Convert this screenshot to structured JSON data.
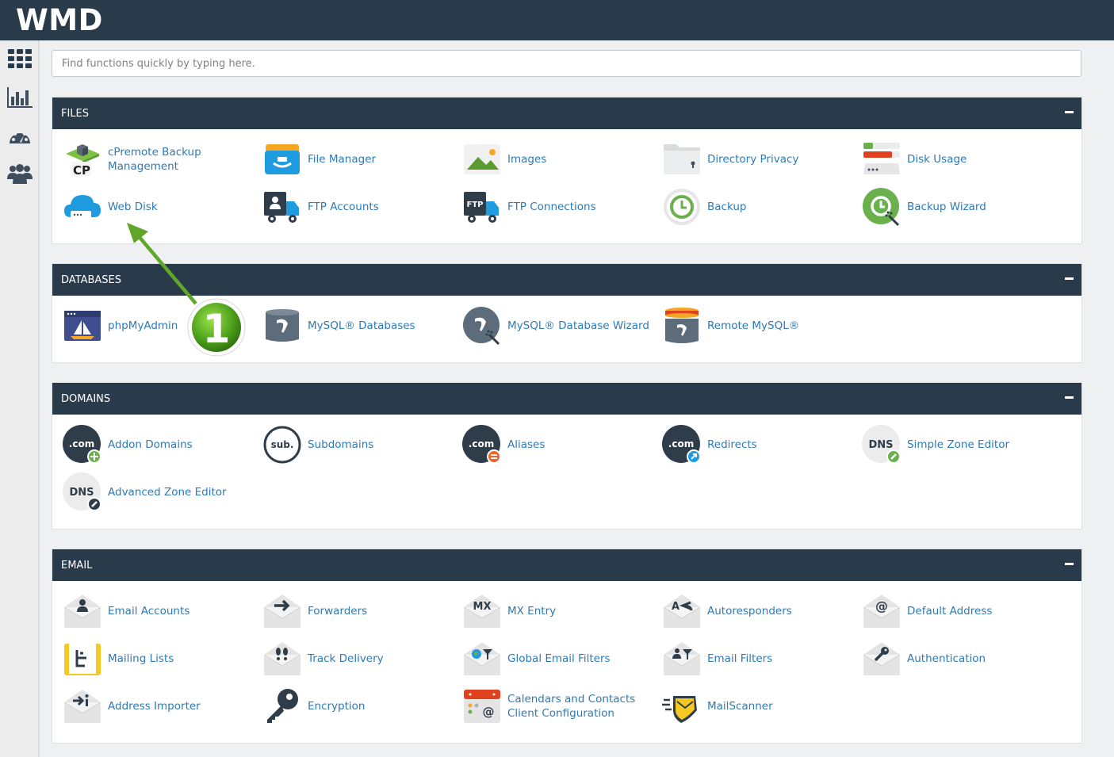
{
  "app": {
    "brand": "WMD"
  },
  "search": {
    "placeholder": "Find functions quickly by typing here."
  },
  "sidebar": [
    {
      "icon": "grid-icon"
    },
    {
      "icon": "bar-chart-icon"
    },
    {
      "icon": "dashboard-gauge-icon"
    },
    {
      "icon": "users-icon"
    }
  ],
  "annotation": {
    "step": "1"
  },
  "sections": {
    "files": {
      "title": "FILES",
      "items": [
        {
          "label": "cPremote Backup Management",
          "icon": "cpremote-backup-icon"
        },
        {
          "label": "File Manager",
          "icon": "file-manager-icon"
        },
        {
          "label": "Images",
          "icon": "images-icon"
        },
        {
          "label": "Directory Privacy",
          "icon": "directory-privacy-icon"
        },
        {
          "label": "Disk Usage",
          "icon": "disk-usage-icon"
        },
        {
          "label": "Web Disk",
          "icon": "web-disk-icon"
        },
        {
          "label": "FTP Accounts",
          "icon": "ftp-accounts-icon"
        },
        {
          "label": "FTP Connections",
          "icon": "ftp-connections-icon"
        },
        {
          "label": "Backup",
          "icon": "backup-icon"
        },
        {
          "label": "Backup Wizard",
          "icon": "backup-wizard-icon"
        }
      ]
    },
    "databases": {
      "title": "DATABASES",
      "items": [
        {
          "label": "phpMyAdmin",
          "icon": "phpmyadmin-icon"
        },
        {
          "label": "MySQL® Databases",
          "icon": "mysql-databases-icon"
        },
        {
          "label": "MySQL® Database Wizard",
          "icon": "mysql-wizard-icon"
        },
        {
          "label": "Remote MySQL®",
          "icon": "remote-mysql-icon"
        }
      ]
    },
    "domains": {
      "title": "DOMAINS",
      "items": [
        {
          "label": "Addon Domains",
          "icon": "addon-domains-icon",
          "badge": ".com"
        },
        {
          "label": "Subdomains",
          "icon": "subdomains-icon",
          "badge": "sub."
        },
        {
          "label": "Aliases",
          "icon": "aliases-icon",
          "badge": ".com"
        },
        {
          "label": "Redirects",
          "icon": "redirects-icon",
          "badge": ".com"
        },
        {
          "label": "Simple Zone Editor",
          "icon": "simple-zone-editor-icon",
          "badge": "DNS"
        },
        {
          "label": "Advanced Zone Editor",
          "icon": "advanced-zone-editor-icon",
          "badge": "DNS"
        }
      ]
    },
    "email": {
      "title": "EMAIL",
      "items": [
        {
          "label": "Email Accounts",
          "icon": "email-accounts-icon"
        },
        {
          "label": "Forwarders",
          "icon": "forwarders-icon"
        },
        {
          "label": "MX Entry",
          "icon": "mx-entry-icon",
          "badge": "MX"
        },
        {
          "label": "Autoresponders",
          "icon": "autoresponders-icon"
        },
        {
          "label": "Default Address",
          "icon": "default-address-icon"
        },
        {
          "label": "Mailing Lists",
          "icon": "mailing-lists-icon"
        },
        {
          "label": "Track Delivery",
          "icon": "track-delivery-icon"
        },
        {
          "label": "Global Email Filters",
          "icon": "global-email-filters-icon"
        },
        {
          "label": "Email Filters",
          "icon": "email-filters-icon"
        },
        {
          "label": "Authentication",
          "icon": "authentication-icon"
        },
        {
          "label": "Address Importer",
          "icon": "address-importer-icon"
        },
        {
          "label": "Encryption",
          "icon": "encryption-icon"
        },
        {
          "label": "Calendars and Contacts Client Configuration",
          "icon": "calendars-contacts-icon"
        },
        {
          "label": "MailScanner",
          "icon": "mailscanner-icon"
        }
      ]
    }
  },
  "colors": {
    "header": "#293a4a",
    "link": "#2e7ab6",
    "icon_dark": "#3e4e5e",
    "accent_green": "#6ab04c",
    "arrow_green": "#5fa62b"
  }
}
